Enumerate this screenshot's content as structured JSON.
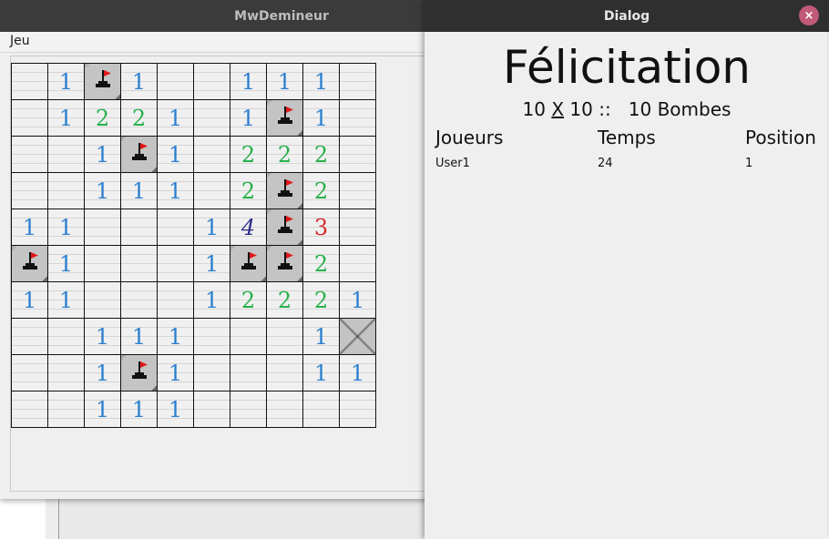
{
  "main_window": {
    "title": "MwDemineur",
    "menu": {
      "jeu_mnemonic": "J",
      "jeu_rest": "eu"
    }
  },
  "board": {
    "rows": [
      [
        "",
        "1",
        "F",
        "1",
        "",
        "",
        "1",
        "1",
        "1",
        ""
      ],
      [
        "",
        "1",
        "2",
        "2",
        "1",
        "",
        "1",
        "F",
        "1",
        ""
      ],
      [
        "",
        "",
        "1",
        "F",
        "1",
        "",
        "2",
        "2",
        "2",
        ""
      ],
      [
        "",
        "",
        "1",
        "1",
        "1",
        "",
        "2",
        "F",
        "2",
        ""
      ],
      [
        "1",
        "1",
        "",
        "",
        "",
        "1",
        "4",
        "F",
        "3",
        ""
      ],
      [
        "F",
        "1",
        "",
        "",
        "",
        "1",
        "F",
        "F",
        "2",
        ""
      ],
      [
        "1",
        "1",
        "",
        "",
        "",
        "1",
        "2",
        "2",
        "2",
        "1"
      ],
      [
        "",
        "",
        "1",
        "1",
        "1",
        "",
        "",
        "",
        "1",
        "H"
      ],
      [
        "",
        "",
        "1",
        "F",
        "1",
        "",
        "",
        "",
        "1",
        "1"
      ],
      [
        "",
        "",
        "1",
        "1",
        "1",
        "",
        "",
        "",
        "",
        ""
      ]
    ],
    "number_colors": {
      "1": "#2b7fcf",
      "2": "#27b04a",
      "3": "#d42a2a",
      "4": "#2d2d8c"
    },
    "flag_icon": "flag-on-mine-icon"
  },
  "dialog": {
    "title": "Dialog",
    "close_icon": "close-icon",
    "close_glyph": "×",
    "heading": "Félicitation",
    "grid_w": "10",
    "grid_x": "X",
    "grid_h": "10",
    "sep": "::",
    "bombs": "10 Bombes",
    "headers": {
      "player": "Joueurs",
      "time": "Temps",
      "position": "Position"
    },
    "scores": [
      {
        "player": "User1",
        "time": "24",
        "position": "1"
      }
    ]
  }
}
